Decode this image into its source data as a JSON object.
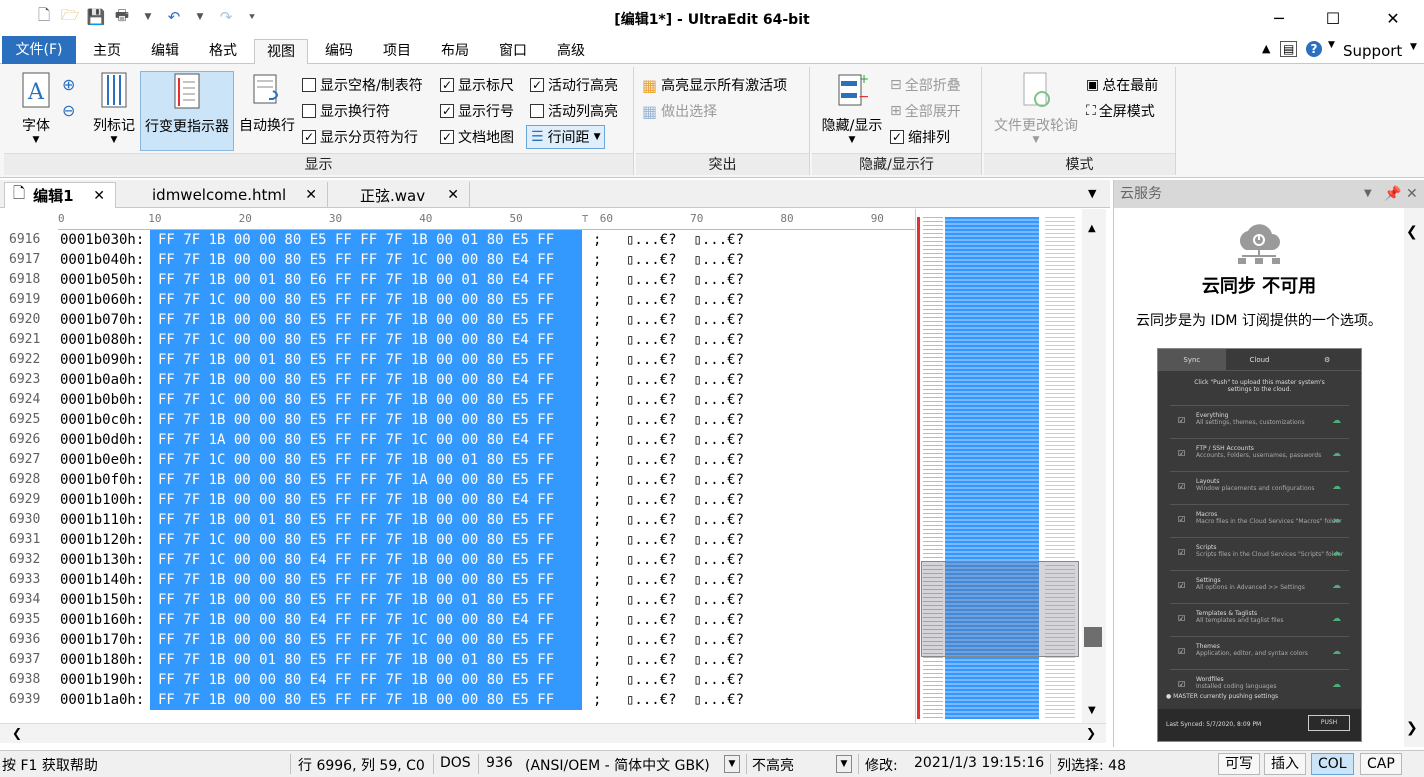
{
  "window": {
    "title": "[编辑1*] - UltraEdit 64-bit",
    "minimize": "─",
    "maximize": "☐",
    "close": "✕"
  },
  "menu": {
    "file": "文件(F)",
    "tabs": [
      "主页",
      "编辑",
      "格式",
      "视图",
      "编码",
      "项目",
      "布局",
      "窗口",
      "高级"
    ],
    "active_tab": "视图",
    "support": "Support"
  },
  "ribbon": {
    "display_group": "显示",
    "font_btn": "字体",
    "colmark_btn": "列标记",
    "linechange_btn": "行变更指示器",
    "wrap_btn": "自动换行",
    "checks": [
      {
        "label": "显示空格/制表符",
        "checked": false
      },
      {
        "label": "显示换行符",
        "checked": false
      },
      {
        "label": "显示分页符为行",
        "checked": true
      },
      {
        "label": "显示标尺",
        "checked": true
      },
      {
        "label": "显示行号",
        "checked": true
      },
      {
        "label": "文档地图",
        "checked": true
      },
      {
        "label": "活动行高亮",
        "checked": true
      },
      {
        "label": "活动列高亮",
        "checked": false
      }
    ],
    "linespacing": "行间距",
    "highlight_group": "突出",
    "highlight_all": "高亮显示所有激活项",
    "make_selection": "做出选择",
    "hide_group": "隐藏/显示行",
    "hide_show_btn": "隐藏/显示",
    "fold_all": "全部折叠",
    "expand_all": "全部展开",
    "indent_col": "缩排列",
    "mode_group": "模式",
    "file_poll": "文件更改轮询",
    "always_top": "总在最前",
    "fullscreen": "全屏模式"
  },
  "doc_tabs": [
    "编辑1",
    "idmwelcome.html",
    "正弦.wav"
  ],
  "ruler": [
    "0",
    "10",
    "20",
    "30",
    "40",
    "50",
    "60",
    "70",
    "80",
    "90"
  ],
  "hex_rows": [
    {
      "line": "6916",
      "addr": "0001b030h:",
      "hex": "FF 7F 1B 00 00 80 E5 FF FF 7F 1B 00 01 80 E5 FF"
    },
    {
      "line": "6917",
      "addr": "0001b040h:",
      "hex": "FF 7F 1B 00 00 80 E5 FF FF 7F 1C 00 00 80 E4 FF"
    },
    {
      "line": "6918",
      "addr": "0001b050h:",
      "hex": "FF 7F 1B 00 01 80 E6 FF FF 7F 1B 00 01 80 E4 FF"
    },
    {
      "line": "6919",
      "addr": "0001b060h:",
      "hex": "FF 7F 1C 00 00 80 E5 FF FF 7F 1B 00 00 80 E5 FF"
    },
    {
      "line": "6920",
      "addr": "0001b070h:",
      "hex": "FF 7F 1B 00 00 80 E5 FF FF 7F 1B 00 00 80 E5 FF"
    },
    {
      "line": "6921",
      "addr": "0001b080h:",
      "hex": "FF 7F 1C 00 00 80 E5 FF FF 7F 1B 00 00 80 E4 FF"
    },
    {
      "line": "6922",
      "addr": "0001b090h:",
      "hex": "FF 7F 1B 00 01 80 E5 FF FF 7F 1B 00 00 80 E5 FF"
    },
    {
      "line": "6923",
      "addr": "0001b0a0h:",
      "hex": "FF 7F 1B 00 00 80 E5 FF FF 7F 1B 00 00 80 E4 FF"
    },
    {
      "line": "6924",
      "addr": "0001b0b0h:",
      "hex": "FF 7F 1C 00 00 80 E5 FF FF 7F 1B 00 00 80 E5 FF"
    },
    {
      "line": "6925",
      "addr": "0001b0c0h:",
      "hex": "FF 7F 1B 00 00 80 E5 FF FF 7F 1B 00 00 80 E5 FF"
    },
    {
      "line": "6926",
      "addr": "0001b0d0h:",
      "hex": "FF 7F 1A 00 00 80 E5 FF FF 7F 1C 00 00 80 E4 FF"
    },
    {
      "line": "6927",
      "addr": "0001b0e0h:",
      "hex": "FF 7F 1C 00 00 80 E5 FF FF 7F 1B 00 01 80 E5 FF"
    },
    {
      "line": "6928",
      "addr": "0001b0f0h:",
      "hex": "FF 7F 1B 00 00 80 E5 FF FF 7F 1A 00 00 80 E5 FF"
    },
    {
      "line": "6929",
      "addr": "0001b100h:",
      "hex": "FF 7F 1B 00 00 80 E5 FF FF 7F 1B 00 00 80 E4 FF"
    },
    {
      "line": "6930",
      "addr": "0001b110h:",
      "hex": "FF 7F 1B 00 01 80 E5 FF FF 7F 1B 00 00 80 E5 FF"
    },
    {
      "line": "6931",
      "addr": "0001b120h:",
      "hex": "FF 7F 1C 00 00 80 E5 FF FF 7F 1B 00 00 80 E5 FF"
    },
    {
      "line": "6932",
      "addr": "0001b130h:",
      "hex": "FF 7F 1C 00 00 80 E4 FF FF 7F 1B 00 00 80 E5 FF"
    },
    {
      "line": "6933",
      "addr": "0001b140h:",
      "hex": "FF 7F 1B 00 00 80 E5 FF FF 7F 1B 00 00 80 E5 FF"
    },
    {
      "line": "6934",
      "addr": "0001b150h:",
      "hex": "FF 7F 1B 00 00 80 E5 FF FF 7F 1B 00 01 80 E5 FF"
    },
    {
      "line": "6935",
      "addr": "0001b160h:",
      "hex": "FF 7F 1B 00 00 80 E4 FF FF 7F 1C 00 00 80 E4 FF"
    },
    {
      "line": "6936",
      "addr": "0001b170h:",
      "hex": "FF 7F 1B 00 00 80 E5 FF FF 7F 1C 00 00 80 E5 FF"
    },
    {
      "line": "6937",
      "addr": "0001b180h:",
      "hex": "FF 7F 1B 00 01 80 E5 FF FF 7F 1B 00 01 80 E5 FF"
    },
    {
      "line": "6938",
      "addr": "0001b190h:",
      "hex": "FF 7F 1B 00 00 80 E4 FF FF 7F 1B 00 00 80 E5 FF"
    },
    {
      "line": "6939",
      "addr": "0001b1a0h:",
      "hex": "FF 7F 1B 00 00 80 E5 FF FF 7F 1B 00 00 80 E5 FF"
    }
  ],
  "hex_sep": ";",
  "hex_ascii": "▯...€?  ▯...€?",
  "cloud": {
    "panel_title": "云服务",
    "heading": "云同步 不可用",
    "desc": "云同步是为 IDM 订阅提供的一个选项。",
    "shot_tabs": [
      "Sync",
      "Cloud"
    ],
    "shot_hint": "Click \"Push\" to upload this master system's settings to the cloud.",
    "shot_items": [
      {
        "name": "Everything",
        "sub": "All settings, themes, customizations"
      },
      {
        "name": "FTP / SSH Accounts",
        "sub": "Accounts, Folders, usernames, passwords"
      },
      {
        "name": "Layouts",
        "sub": "Window placements and configurations"
      },
      {
        "name": "Macros",
        "sub": "Macro files in the Cloud Services \"Macros\" folder"
      },
      {
        "name": "Scripts",
        "sub": "Scripts files in the Cloud Services \"Scripts\" folder"
      },
      {
        "name": "Settings",
        "sub": "All options in Advanced >> Settings"
      },
      {
        "name": "Templates & Taglists",
        "sub": "All templates and taglist files"
      },
      {
        "name": "Themes",
        "sub": "Application, editor, and syntax colors"
      },
      {
        "name": "Wordfiles",
        "sub": "Installed coding languages"
      }
    ],
    "shot_master": "● MASTER currently pushing settings",
    "shot_last": "Last Synced: 5/7/2020, 8:09 PM",
    "shot_push": "PUSH"
  },
  "status": {
    "help": "按 F1 获取帮助",
    "pos": "行 6996, 列 59, C0",
    "eol": "DOS",
    "codepage": "936",
    "encoding": "(ANSI/OEM - 简体中文 GBK)",
    "highlight": "不高亮",
    "modified": "修改:",
    "mtime": "2021/1/3 19:15:16",
    "colsel": "列选择: 48",
    "writable": "可写",
    "insert": "插入",
    "col": "COL",
    "cap": "CAP"
  },
  "colors": {
    "accent": "#2b6fbf",
    "selection": "#3399ff"
  }
}
